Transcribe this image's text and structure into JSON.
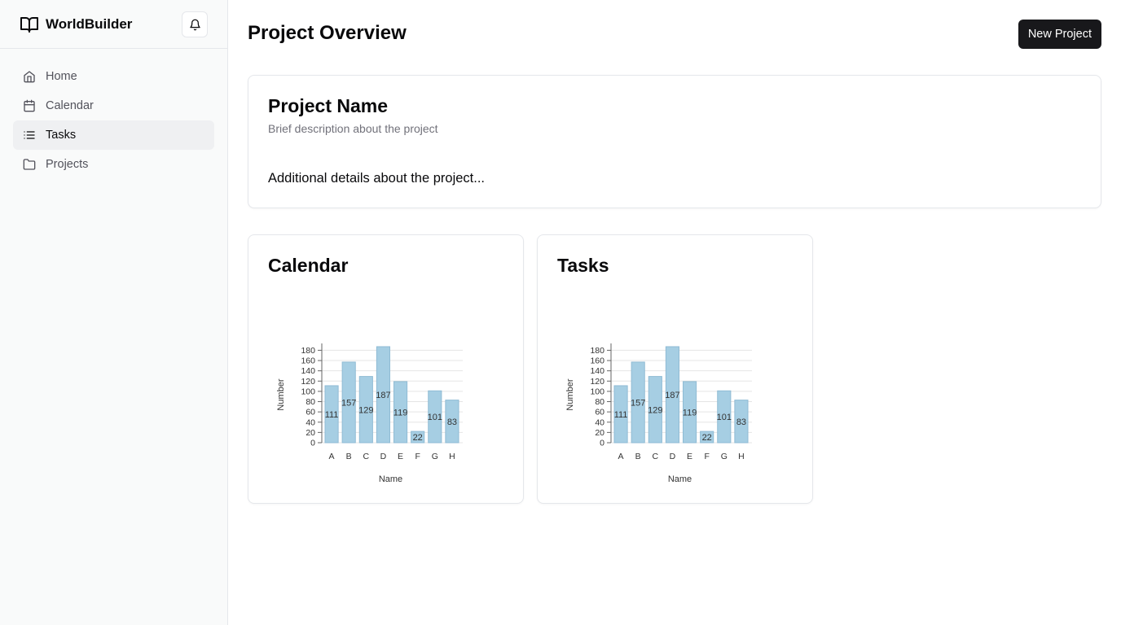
{
  "app": {
    "name": "WorldBuilder"
  },
  "icons": {
    "brand": "book-open-icon",
    "notifications": "bell-icon"
  },
  "sidebar": {
    "items": [
      {
        "label": "Home",
        "icon": "home-icon",
        "active": false
      },
      {
        "label": "Calendar",
        "icon": "calendar-icon",
        "active": false
      },
      {
        "label": "Tasks",
        "icon": "list-icon",
        "active": true
      },
      {
        "label": "Projects",
        "icon": "folder-icon",
        "active": false
      }
    ]
  },
  "header": {
    "title": "Project Overview",
    "new_project_label": "New Project"
  },
  "project": {
    "name": "Project Name",
    "description": "Brief description about the project",
    "details": "Additional details about the project..."
  },
  "colors": {
    "bar_fill": "#a6cee3",
    "bar_stroke": "#8fbbd4",
    "button_bg": "#18181b",
    "sidebar_bg": "#f9fafa"
  },
  "charts": [
    {
      "title": "Calendar"
    },
    {
      "title": "Tasks"
    }
  ],
  "chart_data": [
    {
      "type": "bar",
      "title": "Calendar",
      "categories": [
        "A",
        "B",
        "C",
        "D",
        "E",
        "F",
        "G",
        "H"
      ],
      "values": [
        111,
        157,
        129,
        187,
        119,
        22,
        101,
        83
      ],
      "xlabel": "Name",
      "ylabel": "Number",
      "yticks": [
        0,
        20,
        40,
        60,
        80,
        100,
        120,
        140,
        160,
        180
      ],
      "ylim": [
        0,
        187
      ],
      "grid": true,
      "data_labels": true
    },
    {
      "type": "bar",
      "title": "Tasks",
      "categories": [
        "A",
        "B",
        "C",
        "D",
        "E",
        "F",
        "G",
        "H"
      ],
      "values": [
        111,
        157,
        129,
        187,
        119,
        22,
        101,
        83
      ],
      "xlabel": "Name",
      "ylabel": "Number",
      "yticks": [
        0,
        20,
        40,
        60,
        80,
        100,
        120,
        140,
        160,
        180
      ],
      "ylim": [
        0,
        187
      ],
      "grid": true,
      "data_labels": true
    }
  ]
}
